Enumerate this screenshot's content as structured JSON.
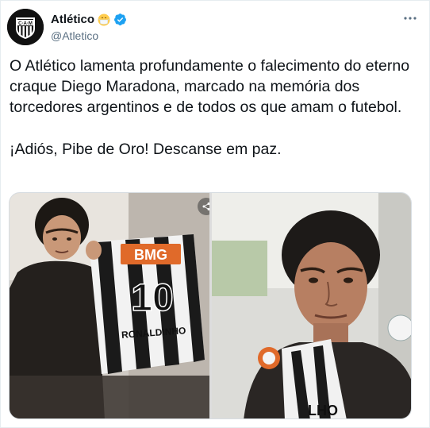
{
  "account": {
    "display_name": "Atlético",
    "handle": "@Atletico",
    "avatar_text": "C·A·M",
    "emoji_icon": "face-with-mask-emoji",
    "verified_icon": "verified-badge-icon"
  },
  "tweet": {
    "paragraph_1": "O Atlético lamenta profundamente o falecimento do eterno craque Diego Maradona, marcado na memória dos torcedores argentinos e de todos os que amam o futebol.",
    "paragraph_2": "¡Adiós, Pibe de Oro! Descanse em paz."
  },
  "photos": {
    "left": {
      "jersey_sponsor": "BMG",
      "jersey_number": "10",
      "jersey_name": "RONALDINHO"
    },
    "right": {
      "shirt_text": "LHO"
    }
  },
  "colors": {
    "verified_blue": "#1da1f2",
    "text_primary": "#0f1419",
    "text_secondary": "#5b7083"
  }
}
